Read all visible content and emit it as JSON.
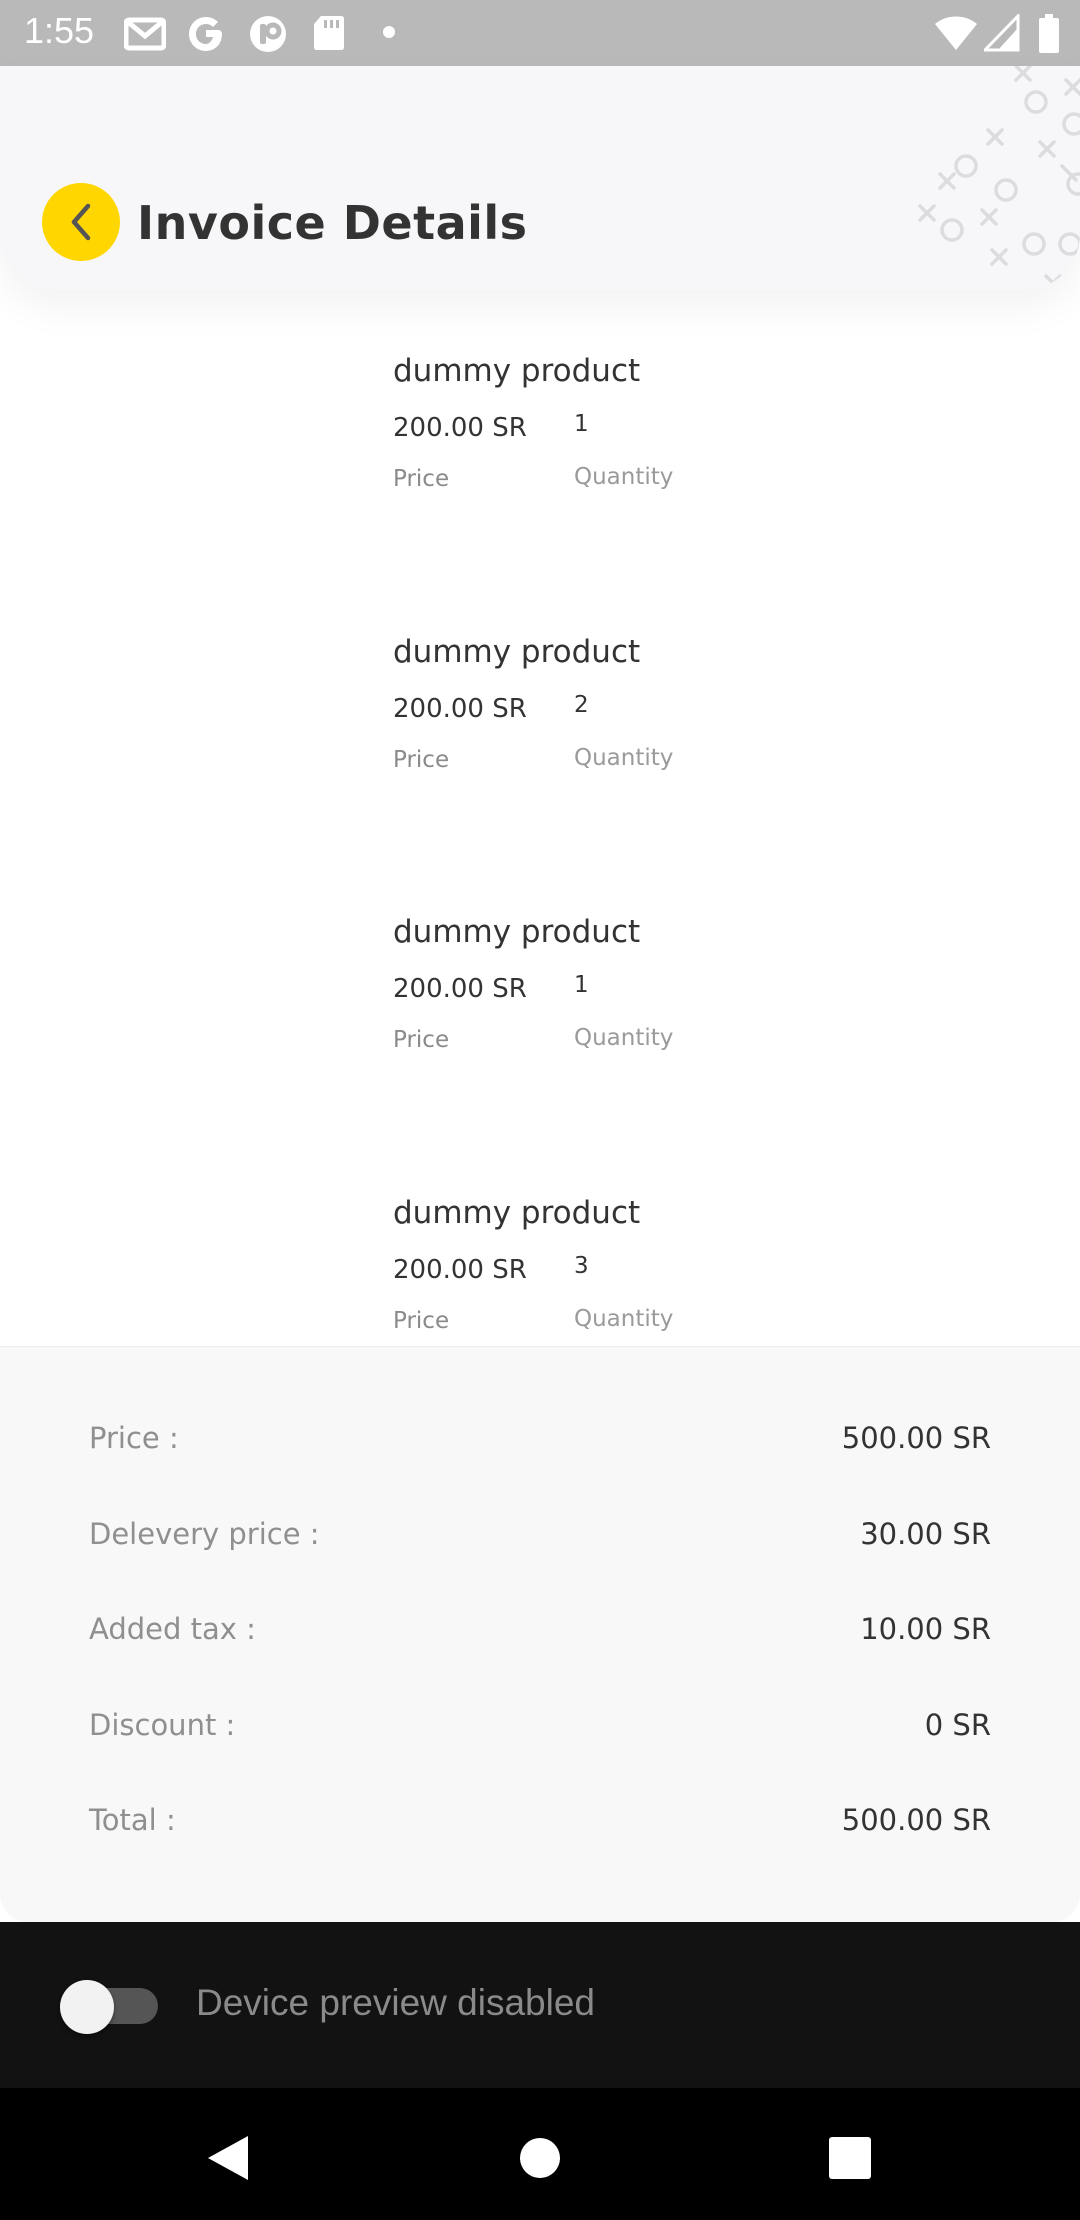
{
  "status_bar": {
    "time": "1:55",
    "left_icons": [
      "gmail-icon",
      "google-icon",
      "app-icon",
      "sd-card-icon",
      "dot-icon"
    ],
    "right_icons": [
      "wifi-icon",
      "signal-icon",
      "battery-icon"
    ],
    "background": "#b9b9b9"
  },
  "header": {
    "title": "Invoice Details",
    "back_icon": "chevron-left-icon",
    "accent": "#ffd600"
  },
  "products": [
    {
      "name": "dummy product",
      "price": "200.00 SR",
      "quantity": "1",
      "price_label": "Price",
      "quantity_label": "Quantity"
    },
    {
      "name": "dummy product",
      "price": "200.00 SR",
      "quantity": "2",
      "price_label": "Price",
      "quantity_label": "Quantity"
    },
    {
      "name": "dummy product",
      "price": "200.00 SR",
      "quantity": "1",
      "price_label": "Price",
      "quantity_label": "Quantity"
    },
    {
      "name": "dummy product",
      "price": "200.00 SR",
      "quantity": "3",
      "price_label": "Price",
      "quantity_label": "Quantity"
    }
  ],
  "summary": {
    "rows": [
      {
        "label": "Price :",
        "value": "500.00 SR"
      },
      {
        "label": "Delevery price :",
        "value": "30.00 SR"
      },
      {
        "label": "Added tax :",
        "value": "10.00 SR"
      },
      {
        "label": "Discount :",
        "value": "0 SR"
      },
      {
        "label": "Total :",
        "value": "500.00 SR"
      }
    ]
  },
  "device_preview": {
    "label": "Device preview disabled",
    "enabled": false
  },
  "nav_bar": {
    "buttons": [
      "back-triangle-icon",
      "home-circle-icon",
      "recents-square-icon"
    ]
  }
}
